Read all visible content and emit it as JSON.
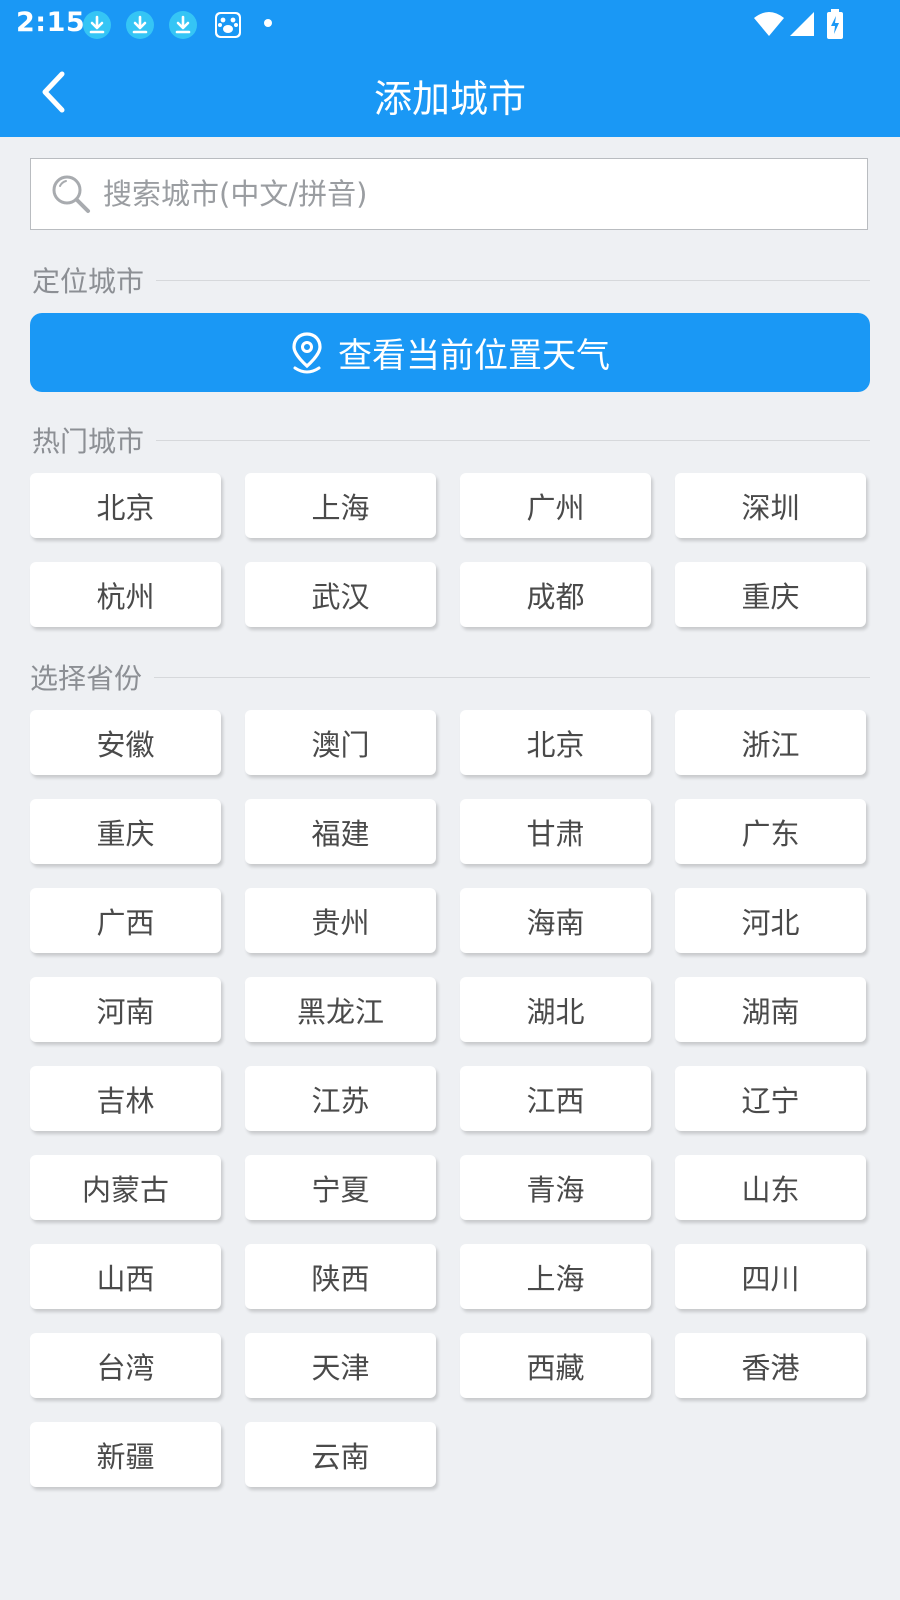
{
  "status_bar": {
    "time": "2:15"
  },
  "app_bar": {
    "title": "添加城市"
  },
  "search": {
    "placeholder": "搜索城市(中文/拼音)"
  },
  "location_section": {
    "heading": "定位城市",
    "button_label": "查看当前位置天气"
  },
  "hot_section": {
    "heading": "热门城市",
    "cities": [
      "北京",
      "上海",
      "广州",
      "深圳",
      "杭州",
      "武汉",
      "成都",
      "重庆"
    ]
  },
  "province_section": {
    "heading": "选择省份",
    "provinces": [
      "安徽",
      "澳门",
      "北京",
      "浙江",
      "重庆",
      "福建",
      "甘肃",
      "广东",
      "广西",
      "贵州",
      "海南",
      "河北",
      "河南",
      "黑龙江",
      "湖北",
      "湖南",
      "吉林",
      "江苏",
      "江西",
      "辽宁",
      "内蒙古",
      "宁夏",
      "青海",
      "山东",
      "山西",
      "陕西",
      "上海",
      "四川",
      "台湾",
      "天津",
      "西藏",
      "香港",
      "新疆",
      "云南"
    ]
  },
  "colors": {
    "accent": "#1a98f5",
    "background": "#eef0f3"
  }
}
